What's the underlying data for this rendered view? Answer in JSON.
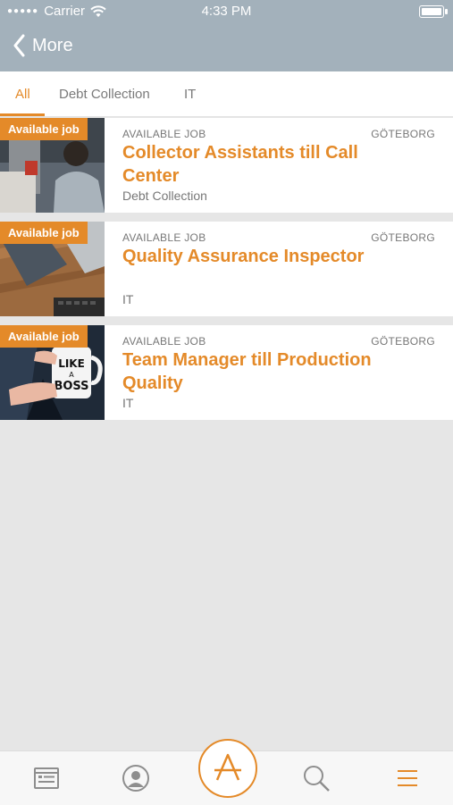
{
  "status_bar": {
    "carrier": "Carrier",
    "time": "4:33 PM"
  },
  "nav": {
    "back_label": "More"
  },
  "tabs": [
    {
      "label": "All",
      "active": true
    },
    {
      "label": "Debt Collection",
      "active": false
    },
    {
      "label": "IT",
      "active": false
    }
  ],
  "jobs": [
    {
      "badge": "Available job",
      "status": "AVAILABLE JOB",
      "city": "GÖTEBORG",
      "title": "Collector Assistants till Call Center",
      "category": "Debt Collection"
    },
    {
      "badge": "Available job",
      "status": "AVAILABLE JOB",
      "city": "GÖTEBORG",
      "title": "Quality Assurance Inspector",
      "category": "IT"
    },
    {
      "badge": "Available job",
      "status": "AVAILABLE JOB",
      "city": "GÖTEBORG",
      "title": "Team Manager till Production Quality",
      "category": "IT",
      "mug_text": "LIKE A BOSS"
    }
  ],
  "tabbar": {
    "items": [
      "list-icon",
      "profile-icon",
      "app-logo-button",
      "search-icon",
      "menu-icon"
    ]
  },
  "colors": {
    "accent": "#e48a29",
    "header": "#a3b1bb"
  }
}
